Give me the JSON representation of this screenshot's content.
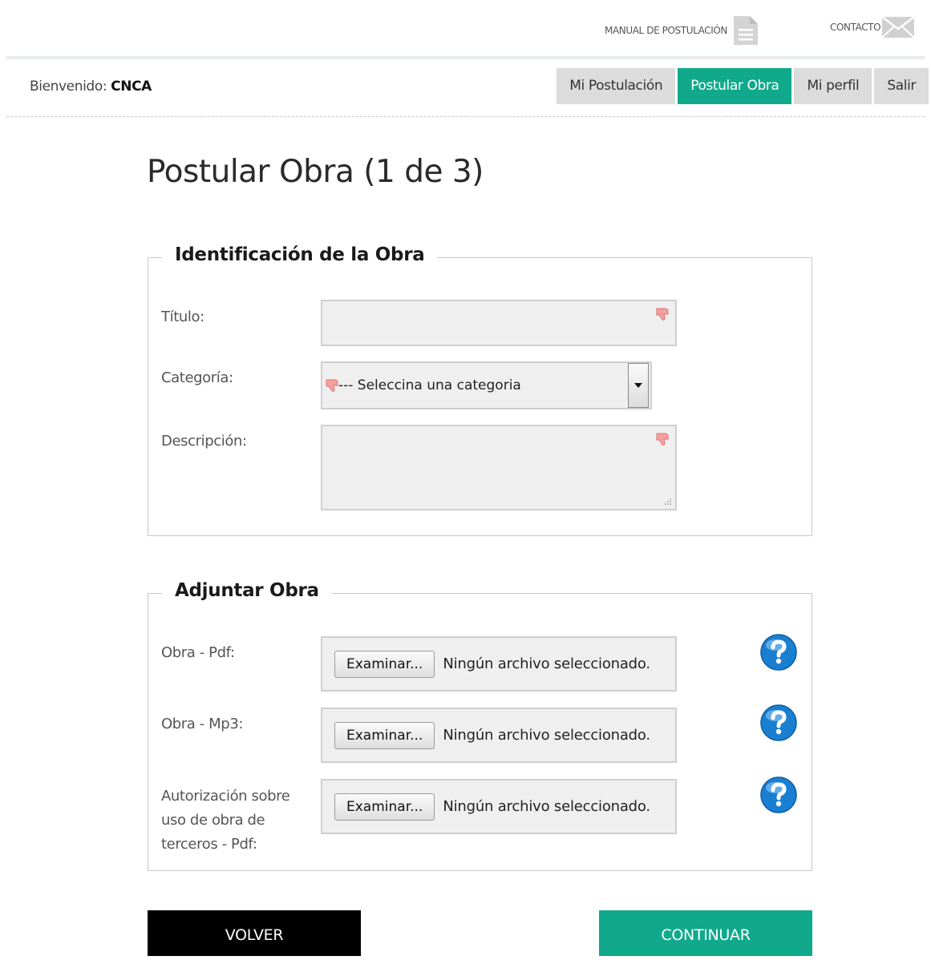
{
  "utility": {
    "manual_label": "MANUAL DE POSTULACIÓN",
    "contact_label": "CONTACTO"
  },
  "welcome": {
    "prefix": "Bienvenido:",
    "user": "CNCA"
  },
  "nav": {
    "tabs": [
      {
        "label": "Mi Postulación",
        "active": false
      },
      {
        "label": "Postular Obra",
        "active": true
      },
      {
        "label": "Mi perfil",
        "active": false
      },
      {
        "label": "Salir",
        "active": false
      }
    ]
  },
  "page_title": "Postular Obra (1 de 3)",
  "identificacion": {
    "legend": "Identificación de la Obra",
    "titulo_label": "Título:",
    "titulo_value": "",
    "categoria_label": "Categoría:",
    "categoria_selected": "--- Seleccina una categoria",
    "descripcion_label": "Descripción:",
    "descripcion_value": ""
  },
  "adjuntar": {
    "legend": "Adjuntar Obra",
    "files": [
      {
        "label": "Obra - Pdf:",
        "button": "Examinar...",
        "status": "Ningún archivo seleccionado."
      },
      {
        "label": "Obra - Mp3:",
        "button": "Examinar...",
        "status": "Ningún archivo seleccionado."
      },
      {
        "label": "Autorización sobre uso de obra de terceros - Pdf:",
        "button": "Examinar...",
        "status": "Ningún archivo seleccionado."
      }
    ]
  },
  "actions": {
    "back_label": "VOLVER",
    "continue_label": "CONTINUAR"
  },
  "colors": {
    "accent": "#10a98b",
    "black": "#000000",
    "help": "#1a7fd0",
    "required": "#f08a8a"
  }
}
